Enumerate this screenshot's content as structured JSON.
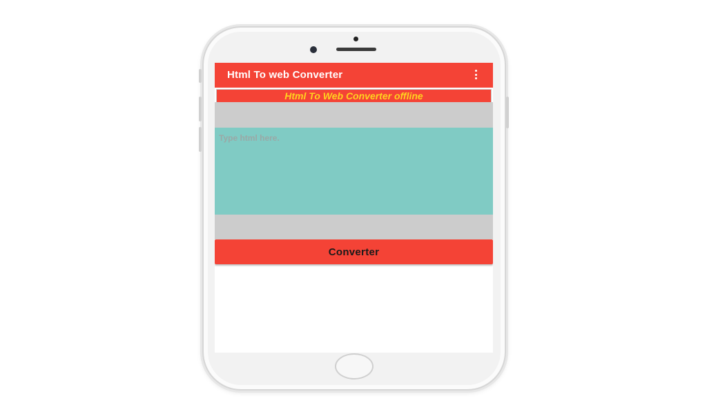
{
  "app": {
    "title": "Html To web Converter",
    "menu_icon": "overflow-menu-icon"
  },
  "banner": {
    "text": "Html To Web Converter offline"
  },
  "editor": {
    "placeholder": "Type html here.",
    "value": ""
  },
  "actions": {
    "convert_label": "Converter"
  },
  "colors": {
    "toolbar": "#f44336",
    "banner_text": "#ffd21f",
    "editor_bg": "#80cbc4",
    "panel_gray": "#cccccc",
    "button": "#f44336"
  }
}
